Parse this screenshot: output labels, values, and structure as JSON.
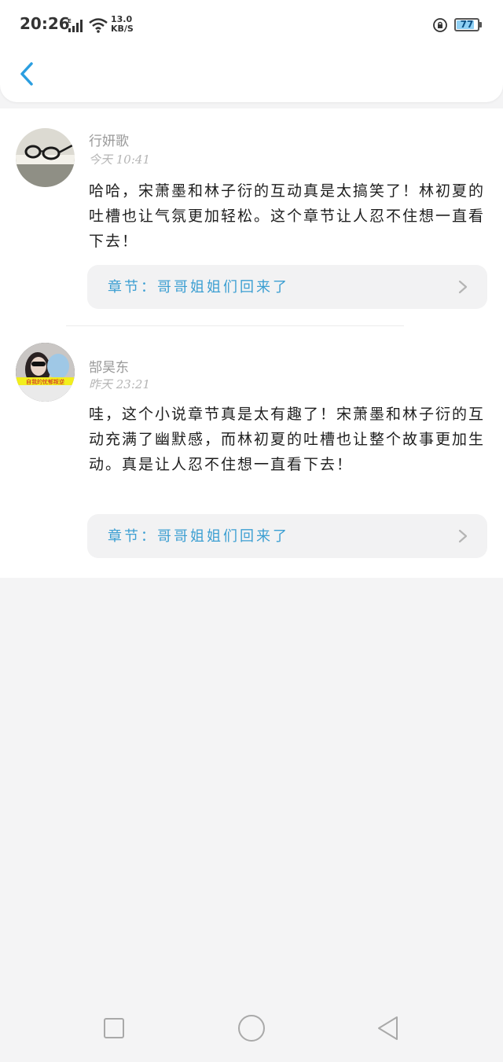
{
  "status_bar": {
    "time": "20:26",
    "network_type": "E",
    "speed_value": "13.0",
    "speed_unit": "KB/S",
    "battery": "77"
  },
  "header": {
    "back_icon": "chevron-left-icon",
    "accent_color": "#2b9ee0"
  },
  "comments": [
    {
      "username": "行妍歌",
      "time": "今天 10:41",
      "text": "哈哈，宋萧墨和林子衍的互动真是太搞笑了！林初夏的吐槽也让气氛更加轻松。这个章节让人忍不住想一直看下去！",
      "chapter_label": "章节：哥哥姐姐们回来了"
    },
    {
      "username": "郜昊东",
      "time": "昨天 23:21",
      "avatar_caption": "自我的忧郁叛逆",
      "text": "哇，这个小说章节真是太有趣了！宋萧墨和林子衍的互动充满了幽默感，而林初夏的吐槽也让整个故事更加生动。真是让人忍不住想一直看下去！",
      "chapter_label": "章节：哥哥姐姐们回来了"
    }
  ],
  "colors": {
    "link": "#3c9fd2",
    "background": "#f4f4f5",
    "card": "#ffffff"
  }
}
